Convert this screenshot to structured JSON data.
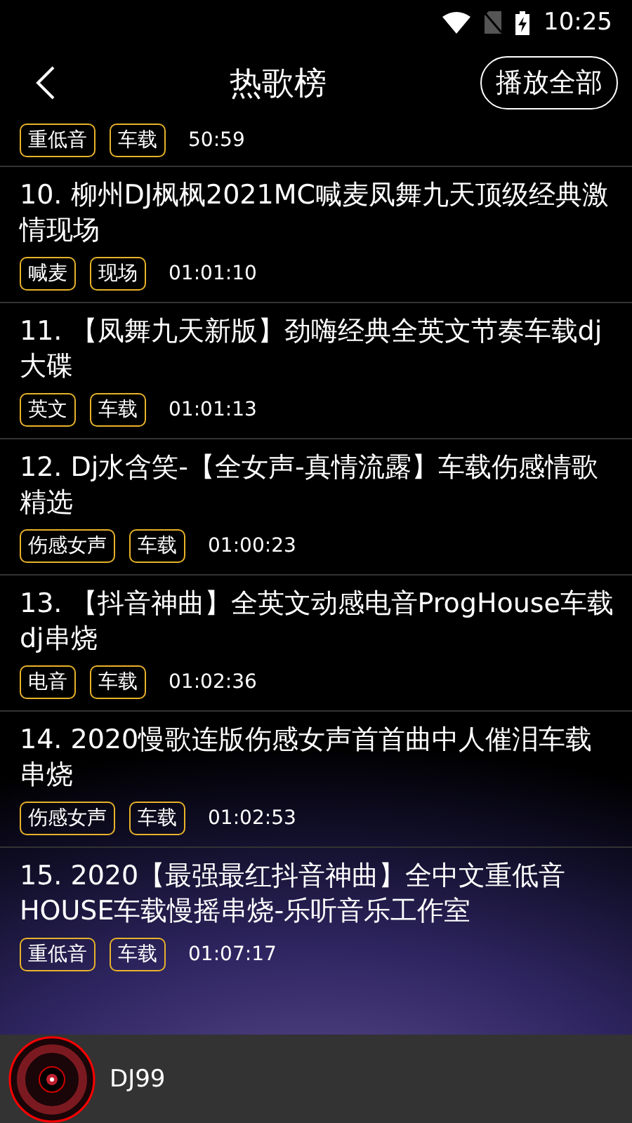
{
  "status_bar": {
    "time": "10:25"
  },
  "header": {
    "title": "热歌榜",
    "play_all": "播放全部"
  },
  "top_partial": {
    "tags": [
      "重低音",
      "车载"
    ],
    "duration": "50:59"
  },
  "songs": [
    {
      "title": "10. 柳州DJ枫枫2021MC喊麦凤舞九天顶级经典激情现场",
      "tags": [
        "喊麦",
        "现场"
      ],
      "duration": "01:01:10"
    },
    {
      "title": "11. 【凤舞九天新版】劲嗨经典全英文节奏车载dj大碟",
      "tags": [
        "英文",
        "车载"
      ],
      "duration": "01:01:13"
    },
    {
      "title": "12. Dj水含笑-【全女声-真情流露】车载伤感情歌精选",
      "tags": [
        "伤感女声",
        "车载"
      ],
      "duration": "01:00:23"
    },
    {
      "title": "13. 【抖音神曲】全英文动感电音ProgHouse车载dj串烧",
      "tags": [
        "电音",
        "车载"
      ],
      "duration": "01:02:36"
    },
    {
      "title": "14. 2020慢歌连版伤感女声首首曲中人催泪车载串烧",
      "tags": [
        "伤感女声",
        "车载"
      ],
      "duration": "01:02:53"
    },
    {
      "title": "15. 2020【最强最红抖音神曲】全中文重低音HOUSE车载慢摇串烧-乐听音乐工作室",
      "tags": [
        "重低音",
        "车载"
      ],
      "duration": "01:07:17"
    }
  ],
  "player": {
    "name": "DJ99"
  }
}
